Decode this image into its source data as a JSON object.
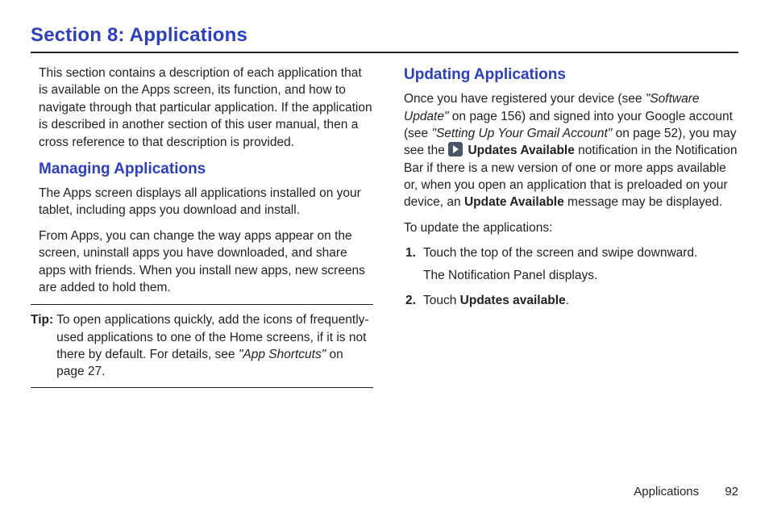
{
  "title": "Section 8: Applications",
  "left": {
    "intro": "This section contains a description of each application that is available on the Apps screen, its function, and how to navigate through that particular application. If the application is described in another section of this user manual, then a cross reference to that description is provided.",
    "heading_managing": "Managing Applications",
    "managing_p1": "The Apps screen displays all applications installed on your tablet, including apps you download and install.",
    "managing_p2": "From Apps, you can change the way apps appear on the screen, uninstall apps you have downloaded, and share apps with friends. When you install new apps, new screens are added to hold them.",
    "tip_label": "Tip:",
    "tip_text_before_ref": "To open applications quickly, add the icons of frequently-used applications to one of the Home screens, if it is not there by default. For details, see ",
    "tip_ref": "\"App Shortcuts\"",
    "tip_text_after_ref": " on page 27."
  },
  "right": {
    "heading_updating": "Updating Applications",
    "p1_a": "Once you have registered your device (see ",
    "p1_ref1": "\"Software Update\"",
    "p1_b": " on page 156) and signed into your Google account (see ",
    "p1_ref2": "\"Setting Up Your Gmail Account\"",
    "p1_c": " on page 52), you may see the ",
    "p1_bold1": "Updates Available",
    "p1_d": " notification in the Notification Bar if there is a new version of one or more apps available or, when you open an application that is preloaded on your device, an ",
    "p1_bold2": "Update Available",
    "p1_e": " message may be displayed.",
    "lead": "To update the applications:",
    "step1": "Touch the top of the screen and swipe downward.",
    "step1_sub": "The Notification Panel displays.",
    "step2_a": "Touch ",
    "step2_bold": "Updates available",
    "step2_b": "."
  },
  "footer": {
    "section": "Applications",
    "page": "92"
  }
}
